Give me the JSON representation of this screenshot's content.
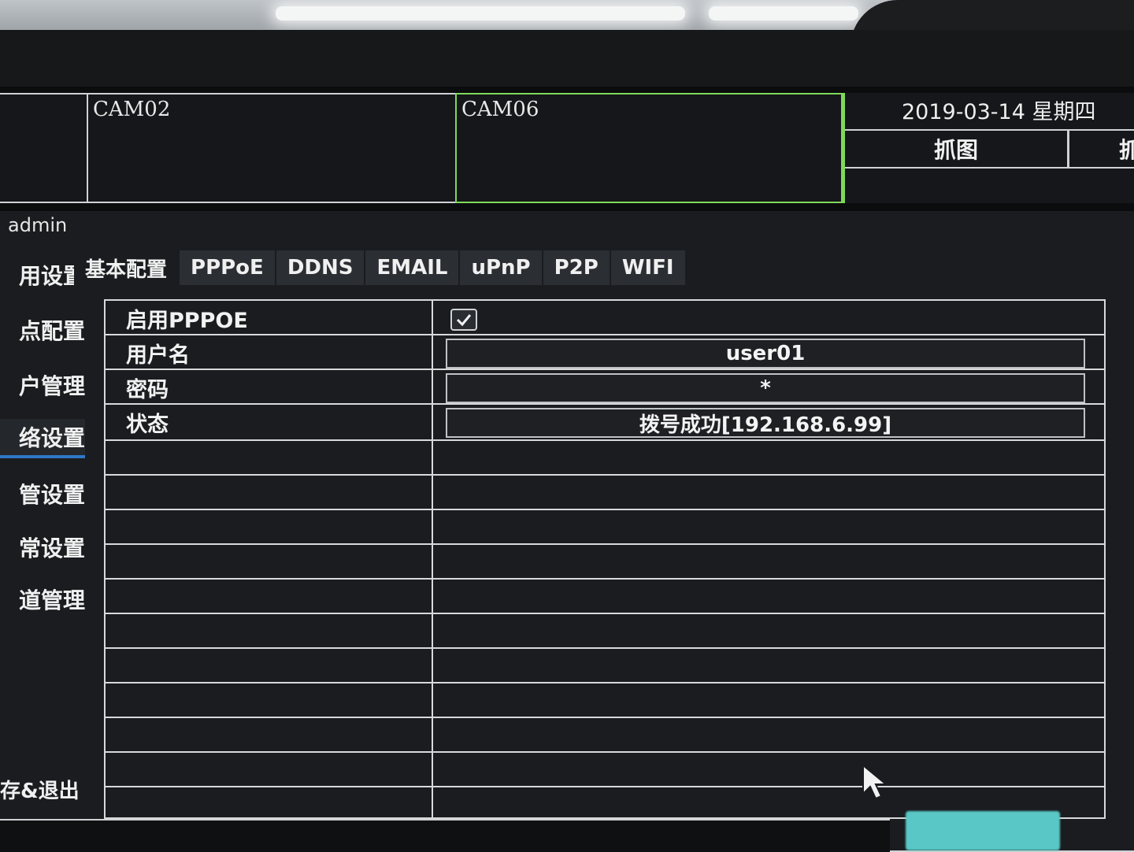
{
  "cameras": [
    {
      "label": "CAM02"
    },
    {
      "label": "CAM06"
    }
  ],
  "datetime": "2019-03-14 星期四",
  "snap_buttons": [
    "抓图",
    "抓"
  ],
  "user": "admin",
  "sidebar": {
    "items": [
      {
        "label": "用设置"
      },
      {
        "label": "点配置"
      },
      {
        "label": "户管理"
      },
      {
        "label": "络设置"
      },
      {
        "label": "管设置"
      },
      {
        "label": "常设置"
      },
      {
        "label": "道管理"
      }
    ],
    "save_exit": "存&退出"
  },
  "tabs": [
    {
      "label": "基本配置"
    },
    {
      "label": "PPPoE"
    },
    {
      "label": "DDNS"
    },
    {
      "label": "EMAIL"
    },
    {
      "label": "uPnP"
    },
    {
      "label": "P2P"
    },
    {
      "label": "WIFI"
    }
  ],
  "pppoe": {
    "enable_label": "启用PPPOE",
    "enabled": true,
    "username_label": "用户名",
    "username": "user01",
    "password_label": "密码",
    "password_mask": "*",
    "status_label": "状态",
    "status": "拨号成功[192.168.6.99]"
  },
  "colors": {
    "accent_active_cam": "#7fd95a",
    "nav_highlight": "#2e78c7",
    "ok_button": "#58c7c5"
  }
}
